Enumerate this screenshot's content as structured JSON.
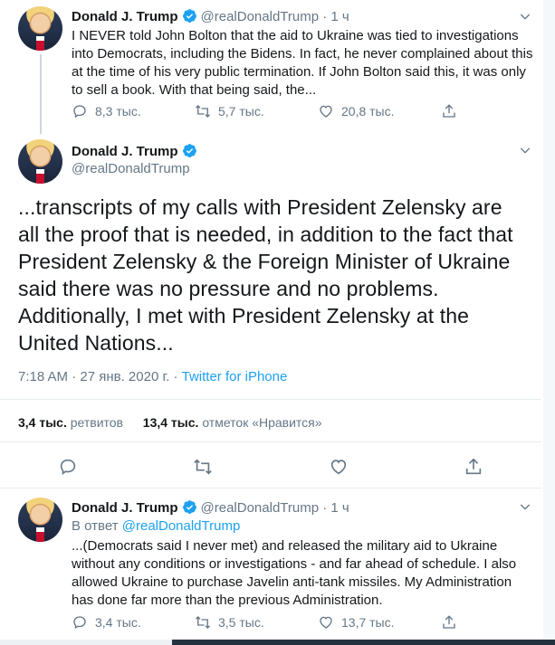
{
  "tweets": [
    {
      "name": "Donald J. Trump",
      "handle": "@realDonaldTrump",
      "time": "· 1 ч",
      "text": "I NEVER told John Bolton that the aid to Ukraine was tied to investigations into Democrats, including the Bidens. In fact, he never complained about this at the time of his very public termination. If John Bolton said this, it was only to sell a book. With that being said, the...",
      "replies": "8,3 тыс.",
      "retweets": "5,7 тыс.",
      "likes": "20,8 тыс."
    },
    {
      "name": "Donald J. Trump",
      "handle": "@realDonaldTrump",
      "text": "...transcripts of my calls with President Zelensky are all the proof that is needed, in addition to the fact that President Zelensky & the Foreign Minister of Ukraine said there was no pressure and no problems. Additionally, I met with President Zelensky at the United Nations...",
      "timestamp": "7:18 AM · 27 янв. 2020 г. · ",
      "source": "Twitter for iPhone",
      "retweet_count": "3,4 тыс.",
      "retweet_label": "ретвитов",
      "like_count": "13,4 тыс.",
      "like_label": "отметок «Нравится»"
    },
    {
      "name": "Donald J. Trump",
      "handle": "@realDonaldTrump",
      "time": "· 1 ч",
      "reply_prefix": "В ответ ",
      "reply_to": "@realDonaldTrump",
      "text": "...(Democrats said I never met) and released the military aid to Ukraine without any conditions or investigations - and far ahead of schedule. I also allowed Ukraine to purchase Javelin anti-tank missiles. My Administration has done far more than the previous Administration.",
      "replies": "3,4 тыс.",
      "retweets": "3,5 тыс.",
      "likes": "13,7 тыс."
    }
  ],
  "colors": {
    "text": "#14171a",
    "secondary": "#657786",
    "accent": "#1da1f2",
    "divider": "#e6ecf0"
  },
  "icons": [
    "verified-icon",
    "chevron-down-icon",
    "reply-icon",
    "retweet-icon",
    "like-icon",
    "share-icon"
  ]
}
